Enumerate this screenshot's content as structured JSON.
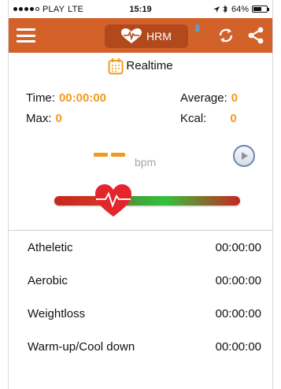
{
  "status_bar": {
    "carrier": "PLAY",
    "network": "LTE",
    "time": "15:19",
    "battery": "64%",
    "battery_level": 0.64
  },
  "header": {
    "title": "HRM"
  },
  "mode_label": "Realtime",
  "stats": {
    "time_label": "Time:",
    "time_value": "00:00:00",
    "average_label": "Average:",
    "average_value": "0",
    "max_label": "Max:",
    "max_value": "0",
    "kcal_label": "Kcal:",
    "kcal_value": "0"
  },
  "bpm_unit": "bpm",
  "zones": [
    {
      "name": "Atheletic",
      "time": "00:00:00"
    },
    {
      "name": "Aerobic",
      "time": "00:00:00"
    },
    {
      "name": "Weightloss",
      "time": "00:00:00"
    },
    {
      "name": "Warm-up/Cool down",
      "time": "00:00:00"
    }
  ],
  "colors": {
    "header": "#d2622a",
    "header_pill": "#b2491c",
    "accent": "#f29a1c",
    "heart": "#e3262b"
  },
  "icons": [
    "menu-icon",
    "heart-pulse-icon",
    "bluetooth-icon",
    "sync-icon",
    "share-icon",
    "calendar-icon",
    "play-icon",
    "heart-rate-icon"
  ]
}
